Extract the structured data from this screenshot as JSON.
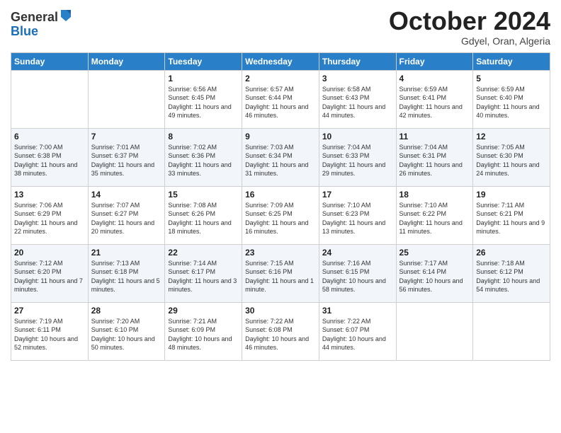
{
  "header": {
    "logo_line1": "General",
    "logo_line2": "Blue",
    "month": "October 2024",
    "location": "Gdyel, Oran, Algeria"
  },
  "weekdays": [
    "Sunday",
    "Monday",
    "Tuesday",
    "Wednesday",
    "Thursday",
    "Friday",
    "Saturday"
  ],
  "weeks": [
    [
      null,
      null,
      {
        "day": "1",
        "sunrise": "Sunrise: 6:56 AM",
        "sunset": "Sunset: 6:45 PM",
        "daylight": "Daylight: 11 hours and 49 minutes."
      },
      {
        "day": "2",
        "sunrise": "Sunrise: 6:57 AM",
        "sunset": "Sunset: 6:44 PM",
        "daylight": "Daylight: 11 hours and 46 minutes."
      },
      {
        "day": "3",
        "sunrise": "Sunrise: 6:58 AM",
        "sunset": "Sunset: 6:43 PM",
        "daylight": "Daylight: 11 hours and 44 minutes."
      },
      {
        "day": "4",
        "sunrise": "Sunrise: 6:59 AM",
        "sunset": "Sunset: 6:41 PM",
        "daylight": "Daylight: 11 hours and 42 minutes."
      },
      {
        "day": "5",
        "sunrise": "Sunrise: 6:59 AM",
        "sunset": "Sunset: 6:40 PM",
        "daylight": "Daylight: 11 hours and 40 minutes."
      }
    ],
    [
      {
        "day": "6",
        "sunrise": "Sunrise: 7:00 AM",
        "sunset": "Sunset: 6:38 PM",
        "daylight": "Daylight: 11 hours and 38 minutes."
      },
      {
        "day": "7",
        "sunrise": "Sunrise: 7:01 AM",
        "sunset": "Sunset: 6:37 PM",
        "daylight": "Daylight: 11 hours and 35 minutes."
      },
      {
        "day": "8",
        "sunrise": "Sunrise: 7:02 AM",
        "sunset": "Sunset: 6:36 PM",
        "daylight": "Daylight: 11 hours and 33 minutes."
      },
      {
        "day": "9",
        "sunrise": "Sunrise: 7:03 AM",
        "sunset": "Sunset: 6:34 PM",
        "daylight": "Daylight: 11 hours and 31 minutes."
      },
      {
        "day": "10",
        "sunrise": "Sunrise: 7:04 AM",
        "sunset": "Sunset: 6:33 PM",
        "daylight": "Daylight: 11 hours and 29 minutes."
      },
      {
        "day": "11",
        "sunrise": "Sunrise: 7:04 AM",
        "sunset": "Sunset: 6:31 PM",
        "daylight": "Daylight: 11 hours and 26 minutes."
      },
      {
        "day": "12",
        "sunrise": "Sunrise: 7:05 AM",
        "sunset": "Sunset: 6:30 PM",
        "daylight": "Daylight: 11 hours and 24 minutes."
      }
    ],
    [
      {
        "day": "13",
        "sunrise": "Sunrise: 7:06 AM",
        "sunset": "Sunset: 6:29 PM",
        "daylight": "Daylight: 11 hours and 22 minutes."
      },
      {
        "day": "14",
        "sunrise": "Sunrise: 7:07 AM",
        "sunset": "Sunset: 6:27 PM",
        "daylight": "Daylight: 11 hours and 20 minutes."
      },
      {
        "day": "15",
        "sunrise": "Sunrise: 7:08 AM",
        "sunset": "Sunset: 6:26 PM",
        "daylight": "Daylight: 11 hours and 18 minutes."
      },
      {
        "day": "16",
        "sunrise": "Sunrise: 7:09 AM",
        "sunset": "Sunset: 6:25 PM",
        "daylight": "Daylight: 11 hours and 16 minutes."
      },
      {
        "day": "17",
        "sunrise": "Sunrise: 7:10 AM",
        "sunset": "Sunset: 6:23 PM",
        "daylight": "Daylight: 11 hours and 13 minutes."
      },
      {
        "day": "18",
        "sunrise": "Sunrise: 7:10 AM",
        "sunset": "Sunset: 6:22 PM",
        "daylight": "Daylight: 11 hours and 11 minutes."
      },
      {
        "day": "19",
        "sunrise": "Sunrise: 7:11 AM",
        "sunset": "Sunset: 6:21 PM",
        "daylight": "Daylight: 11 hours and 9 minutes."
      }
    ],
    [
      {
        "day": "20",
        "sunrise": "Sunrise: 7:12 AM",
        "sunset": "Sunset: 6:20 PM",
        "daylight": "Daylight: 11 hours and 7 minutes."
      },
      {
        "day": "21",
        "sunrise": "Sunrise: 7:13 AM",
        "sunset": "Sunset: 6:18 PM",
        "daylight": "Daylight: 11 hours and 5 minutes."
      },
      {
        "day": "22",
        "sunrise": "Sunrise: 7:14 AM",
        "sunset": "Sunset: 6:17 PM",
        "daylight": "Daylight: 11 hours and 3 minutes."
      },
      {
        "day": "23",
        "sunrise": "Sunrise: 7:15 AM",
        "sunset": "Sunset: 6:16 PM",
        "daylight": "Daylight: 11 hours and 1 minute."
      },
      {
        "day": "24",
        "sunrise": "Sunrise: 7:16 AM",
        "sunset": "Sunset: 6:15 PM",
        "daylight": "Daylight: 10 hours and 58 minutes."
      },
      {
        "day": "25",
        "sunrise": "Sunrise: 7:17 AM",
        "sunset": "Sunset: 6:14 PM",
        "daylight": "Daylight: 10 hours and 56 minutes."
      },
      {
        "day": "26",
        "sunrise": "Sunrise: 7:18 AM",
        "sunset": "Sunset: 6:12 PM",
        "daylight": "Daylight: 10 hours and 54 minutes."
      }
    ],
    [
      {
        "day": "27",
        "sunrise": "Sunrise: 7:19 AM",
        "sunset": "Sunset: 6:11 PM",
        "daylight": "Daylight: 10 hours and 52 minutes."
      },
      {
        "day": "28",
        "sunrise": "Sunrise: 7:20 AM",
        "sunset": "Sunset: 6:10 PM",
        "daylight": "Daylight: 10 hours and 50 minutes."
      },
      {
        "day": "29",
        "sunrise": "Sunrise: 7:21 AM",
        "sunset": "Sunset: 6:09 PM",
        "daylight": "Daylight: 10 hours and 48 minutes."
      },
      {
        "day": "30",
        "sunrise": "Sunrise: 7:22 AM",
        "sunset": "Sunset: 6:08 PM",
        "daylight": "Daylight: 10 hours and 46 minutes."
      },
      {
        "day": "31",
        "sunrise": "Sunrise: 7:22 AM",
        "sunset": "Sunset: 6:07 PM",
        "daylight": "Daylight: 10 hours and 44 minutes."
      },
      null,
      null
    ]
  ]
}
